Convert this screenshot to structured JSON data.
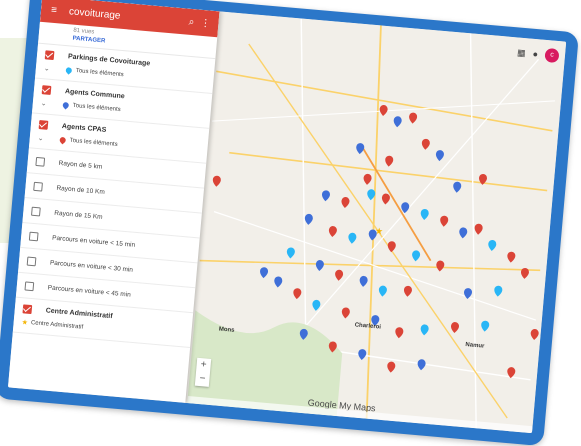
{
  "app": {
    "title": "covoiturage",
    "views": "81 vues",
    "share_label": "PARTAGER"
  },
  "layers": [
    {
      "name": "Parkings de Covoiturage",
      "checked": true,
      "sub": "Tous les éléments",
      "pin_color": "#29b6f6"
    },
    {
      "name": "Agents Commune",
      "checked": true,
      "sub": "Tous les éléments",
      "pin_color": "#3f6fd8"
    },
    {
      "name": "Agents CPAS",
      "checked": true,
      "sub": "Tous les éléments",
      "pin_color": "#db4437"
    }
  ],
  "simple_layers": [
    {
      "name": "Rayon de 5 km"
    },
    {
      "name": "Rayon de 10 Km"
    },
    {
      "name": "Rayon de 15 Km"
    },
    {
      "name": "Parcours en voiture < 15 min"
    },
    {
      "name": "Parcours en voiture < 30 min"
    },
    {
      "name": "Parcours en voiture < 45 min"
    }
  ],
  "admin_layer": {
    "name": "Centre Administratif",
    "item": "Centre Administratif"
  },
  "map": {
    "cities": [
      "Charleroi",
      "Namur",
      "Mons"
    ],
    "watermark": "Google My Maps",
    "zoom_in": "+",
    "zoom_out": "−",
    "avatar_initial": "c"
  },
  "colors": {
    "appbar": "#db4437",
    "frame": "#2b77c9",
    "cpas": "#db4437",
    "commune": "#3f6fd8",
    "parking": "#29b6f6"
  }
}
